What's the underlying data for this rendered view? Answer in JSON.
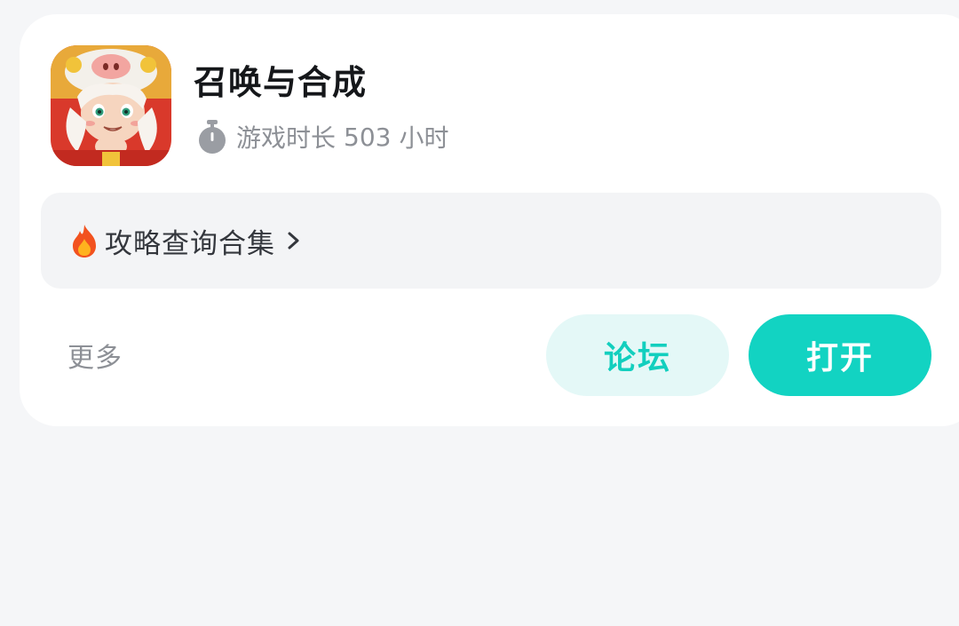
{
  "game": {
    "title": "召唤与合成",
    "icon": "lion-dance-character-icon",
    "playtime_label": "游戏时长",
    "playtime_value": "503",
    "playtime_unit": "小时",
    "playtime_icon": "stopwatch-icon"
  },
  "guide": {
    "label": "攻略查询合集",
    "icon": "fire-icon",
    "chevron": "chevron-right-icon"
  },
  "actions": {
    "more_label": "更多",
    "forum_label": "论坛",
    "open_label": "打开"
  },
  "colors": {
    "accent": "#12d3c2",
    "accent_light": "#e4f8f7",
    "background": "#f5f6f8",
    "card": "#ffffff"
  }
}
